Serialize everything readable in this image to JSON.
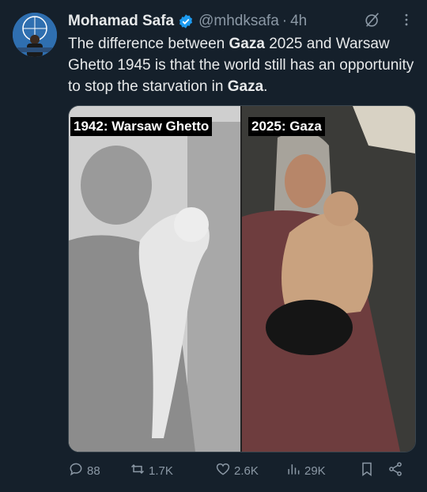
{
  "tweet": {
    "author_name": "Mohamad Safa",
    "handle": "@mhdksafa",
    "separator": "·",
    "time": "4h",
    "text_parts": [
      {
        "t": "The difference between ",
        "bold": false
      },
      {
        "t": "Gaza",
        "bold": true
      },
      {
        "t": " 2025 and Warsaw Ghetto 1945 is that the world still has an opportunity to stop the starvation in ",
        "bold": false
      },
      {
        "t": "Gaza",
        "bold": true
      },
      {
        "t": ".",
        "bold": false
      }
    ]
  },
  "media": {
    "left_caption": "1942: Warsaw Ghetto",
    "right_caption": "2025: Gaza"
  },
  "actions": {
    "replies": "88",
    "reposts": "1.7K",
    "likes": "2.6K",
    "views": "29K"
  },
  "colors": {
    "background": "#15202b",
    "text": "#e7e9ea",
    "muted": "#8b98a5",
    "verified": "#1d9bf0"
  },
  "icons": [
    "grok-icon",
    "more-icon",
    "verified-badge-icon",
    "reply-icon",
    "repost-icon",
    "like-icon",
    "views-icon",
    "bookmark-icon",
    "share-icon"
  ]
}
